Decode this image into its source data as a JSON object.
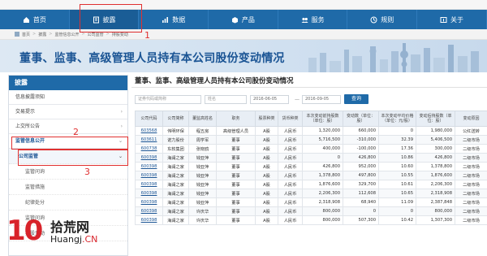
{
  "nav": {
    "items": [
      {
        "label": "首页",
        "icon": "home-icon"
      },
      {
        "label": "披露",
        "icon": "document-icon"
      },
      {
        "label": "数据",
        "icon": "data-icon"
      },
      {
        "label": "产品",
        "icon": "product-icon"
      },
      {
        "label": "服务",
        "icon": "service-icon"
      },
      {
        "label": "规则",
        "icon": "rules-icon"
      },
      {
        "label": "关于",
        "icon": "about-icon"
      }
    ],
    "active_index": 1
  },
  "breadcrumb": [
    "首页",
    "披露",
    "监管信息公开",
    "公司监管",
    "持股变动"
  ],
  "banner": {
    "title": "董事、监事、高级管理人员持有本公司股份变动情况"
  },
  "sidebar": {
    "header": "披露",
    "items": [
      {
        "label": "信息披露须知"
      },
      {
        "label": "交易提示"
      },
      {
        "label": "上交所公告"
      },
      {
        "label": "监管信息公开"
      }
    ],
    "current": "公司监管",
    "subitems": [
      "监管问询",
      "监管措施",
      "纪律处分",
      "监管问询",
      "持股变动"
    ]
  },
  "main": {
    "title": "董事、监事、高级管理人员持有本公司股份变动情况",
    "filters": {
      "code_placeholder": "证券代码或简称",
      "name_placeholder": "姓名",
      "date_from": "2016-06-05",
      "date_to": "2016-09-05",
      "search_label": "查询"
    },
    "columns": [
      "公司代码",
      "公司简称",
      "董监高姓名",
      "职务",
      "股票种类",
      "货币种类",
      "本次变动前持股数（单位：股）",
      "变动数（单位：股）",
      "本次变动平均价格（单位：元/股）",
      "变动后持股数（单位：股）",
      "变动原因"
    ],
    "rows": [
      [
        "603568",
        "伟明环保",
        "程五房",
        "高级管理人员",
        "A股",
        "人民币",
        "1,320,000",
        "660,000",
        "0",
        "1,980,000",
        "公红送转"
      ],
      [
        "603611",
        "诺力股份",
        "周学军",
        "董事",
        "A股",
        "人民币",
        "5,716,500",
        "-310,000",
        "32.39",
        "5,406,500",
        "二级市场"
      ],
      [
        "600738",
        "东软集团",
        "张晓鸥",
        "董事",
        "A股",
        "人民币",
        "400,000",
        "-100,000",
        "17.36",
        "300,000",
        "二级市场"
      ],
      [
        "600398",
        "海澜之家",
        "钱亚萍",
        "董事",
        "A股",
        "人民币",
        "0",
        "426,800",
        "10.86",
        "426,800",
        "二级市场"
      ],
      [
        "600398",
        "海澜之家",
        "钱亚萍",
        "董事",
        "A股",
        "人民币",
        "426,800",
        "952,000",
        "10.60",
        "1,378,800",
        "二级市场"
      ],
      [
        "600398",
        "海澜之家",
        "钱亚萍",
        "董事",
        "A股",
        "人民币",
        "1,378,800",
        "497,800",
        "10.55",
        "1,876,600",
        "二级市场"
      ],
      [
        "600398",
        "海澜之家",
        "钱亚萍",
        "董事",
        "A股",
        "人民币",
        "1,876,600",
        "329,700",
        "10.61",
        "2,206,300",
        "二级市场"
      ],
      [
        "600398",
        "海澜之家",
        "钱亚萍",
        "董事",
        "A股",
        "人民币",
        "2,206,300",
        "112,608",
        "10.65",
        "2,318,908",
        "二级市场"
      ],
      [
        "600398",
        "海澜之家",
        "钱亚萍",
        "董事",
        "A股",
        "人民币",
        "2,318,908",
        "68,940",
        "11.09",
        "2,387,848",
        "二级市场"
      ],
      [
        "600398",
        "海澜之家",
        "许庆华",
        "董事",
        "A股",
        "人民币",
        "800,000",
        "0",
        "0",
        "800,000",
        "二级市场"
      ],
      [
        "600398",
        "海澜之家",
        "许庆华",
        "董事",
        "A股",
        "人民币",
        "800,000",
        "507,300",
        "10.42",
        "1,307,300",
        "二级市场"
      ]
    ]
  },
  "annotations": [
    "1",
    "2",
    "3"
  ],
  "watermark": {
    "number": "10",
    "brand": "拾荒网",
    "url_prefix": "Huangj",
    "url_suffix": ".CN"
  },
  "colors": {
    "primary": "#1f6aa8",
    "annotation": "#e03030",
    "watermark": "#d8232a"
  }
}
